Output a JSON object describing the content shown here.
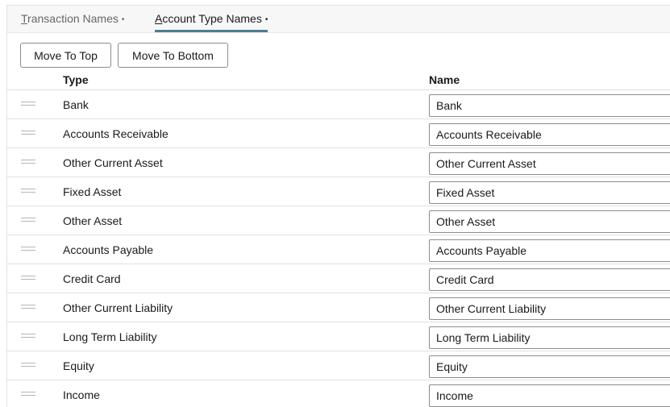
{
  "tabs": [
    {
      "label_first": "T",
      "label_rest": "ransaction Names",
      "dot": "•"
    },
    {
      "label_first": "A",
      "label_rest": "ccount Type Names",
      "dot": "•"
    }
  ],
  "toolbar": {
    "move_top_label": "Move To Top",
    "move_bottom_label": "Move To Bottom"
  },
  "table": {
    "headers": {
      "type": "Type",
      "name": "Name"
    },
    "rows": [
      {
        "type": "Bank",
        "name": "Bank"
      },
      {
        "type": "Accounts Receivable",
        "name": "Accounts Receivable"
      },
      {
        "type": "Other Current Asset",
        "name": "Other Current Asset"
      },
      {
        "type": "Fixed Asset",
        "name": "Fixed Asset"
      },
      {
        "type": "Other Asset",
        "name": "Other Asset"
      },
      {
        "type": "Accounts Payable",
        "name": "Accounts Payable"
      },
      {
        "type": "Credit Card",
        "name": "Credit Card"
      },
      {
        "type": "Other Current Liability",
        "name": "Other Current Liability"
      },
      {
        "type": "Long Term Liability",
        "name": "Long Term Liability"
      },
      {
        "type": "Equity",
        "name": "Equity"
      },
      {
        "type": "Income",
        "name": "Income"
      }
    ]
  }
}
